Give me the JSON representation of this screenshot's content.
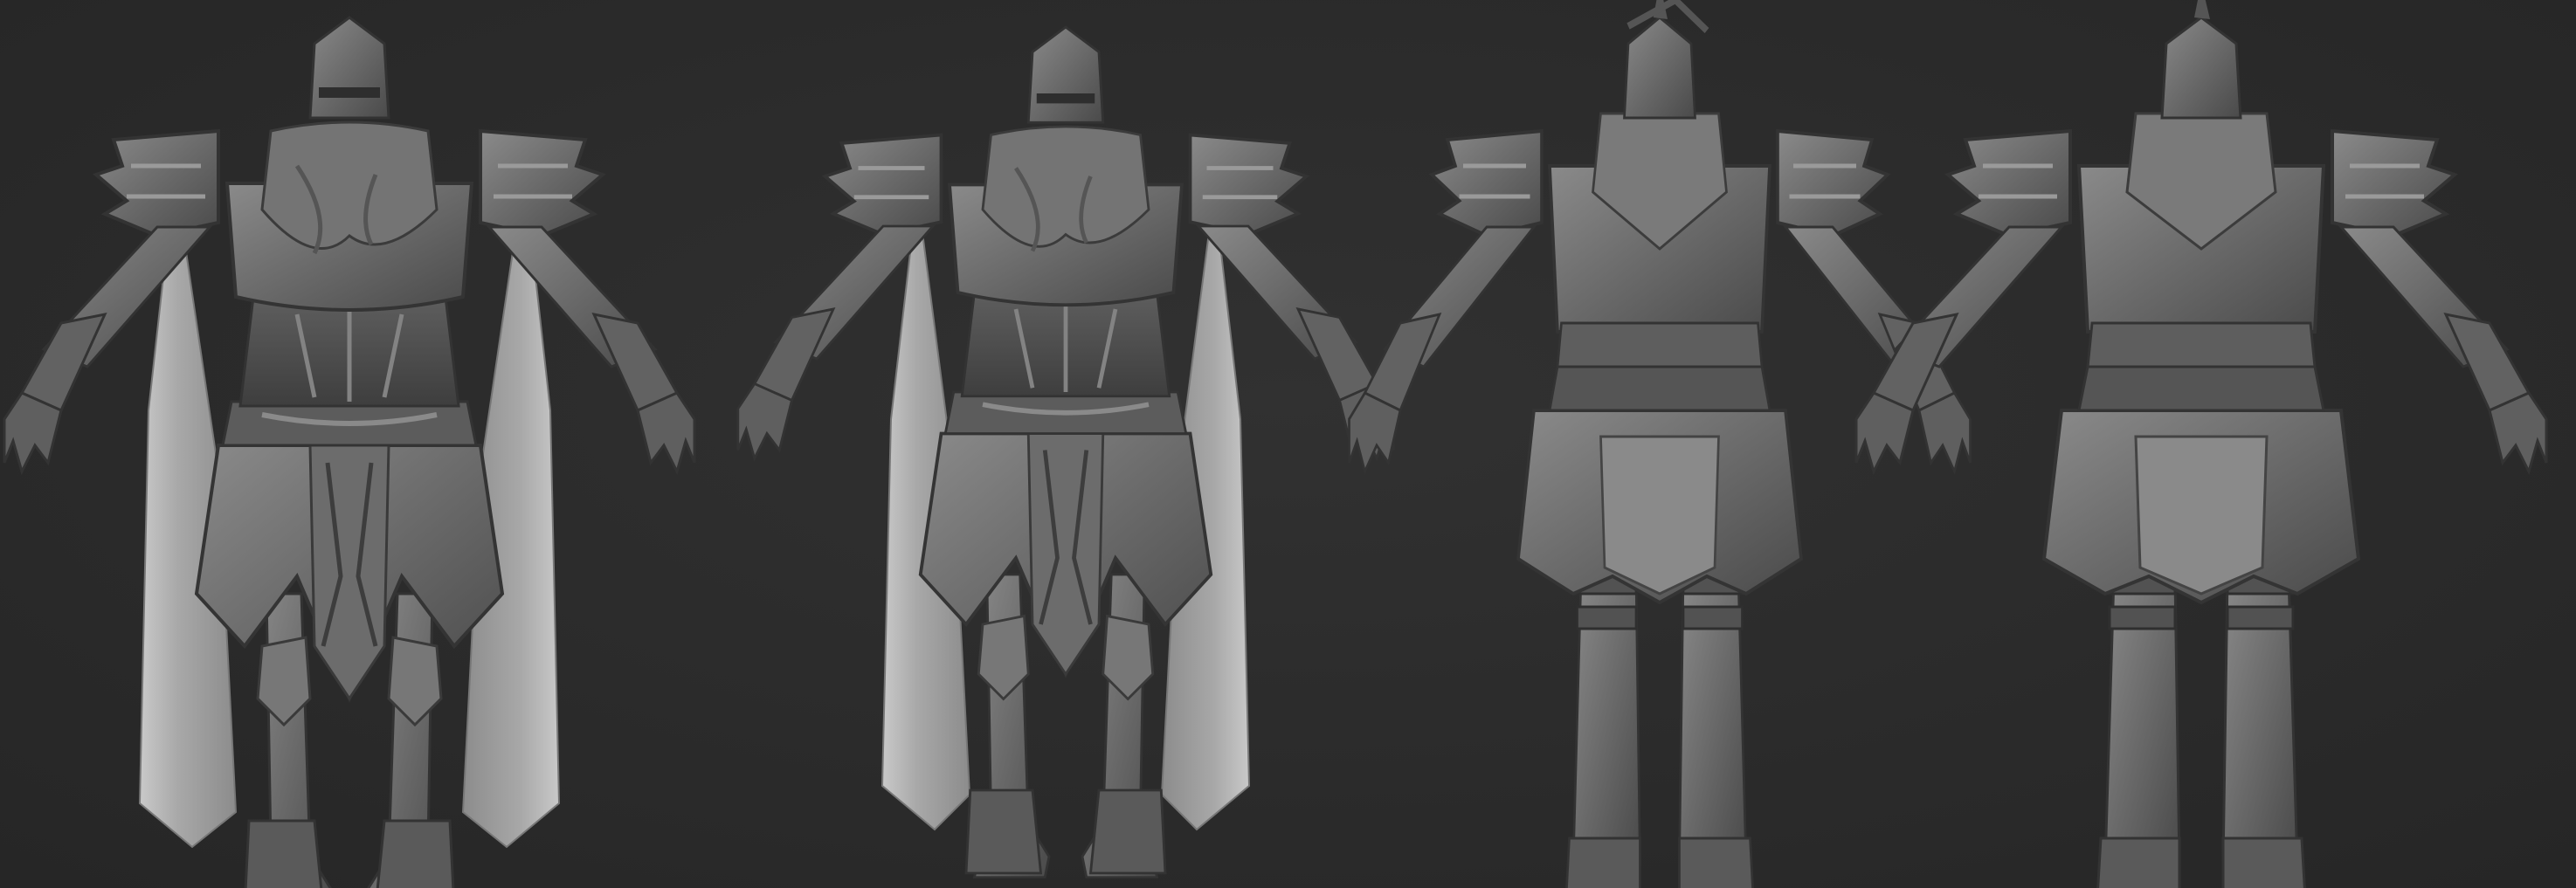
{
  "scene": {
    "background_color": "#2b2b2b",
    "material_color": "#6e6e6e",
    "highlight_color": "#9a9a9a",
    "shadow_color": "#3a3a3a",
    "cape_color": "#b4b4b4",
    "views": [
      {
        "name": "front-view",
        "has_cape": true
      },
      {
        "name": "front-view-alt",
        "has_cape": true
      },
      {
        "name": "three-quarter-back-view",
        "has_cape": false
      },
      {
        "name": "back-view",
        "has_cape": false
      }
    ]
  }
}
